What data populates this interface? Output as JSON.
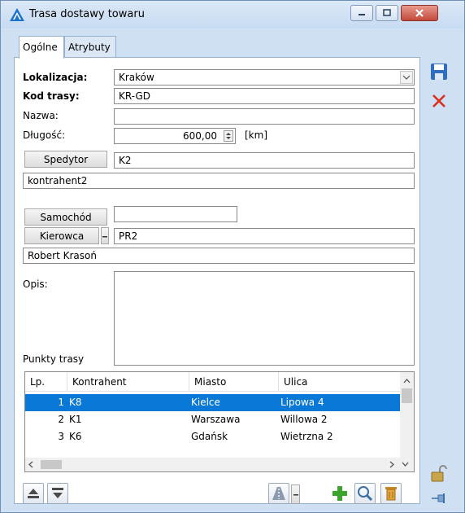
{
  "window": {
    "title": "Trasa dostawy towaru"
  },
  "tabs": [
    {
      "label": "Ogólne"
    },
    {
      "label": "Atrybuty"
    }
  ],
  "form": {
    "lokalizacja_label": "Lokalizacja:",
    "lokalizacja_value": "Kraków",
    "kod_label": "Kod trasy:",
    "kod_value": "KR-GD",
    "nazwa_label": "Nazwa:",
    "nazwa_value": "",
    "dlugosc_label": "Długość:",
    "dlugosc_value": "600,00",
    "dlugosc_unit": "[km]",
    "spedytor_button": "Spedytor",
    "spedytor_code": "K2",
    "spedytor_name": "kontrahent2",
    "samochod_button": "Samochód",
    "samochod_value": "",
    "kierowca_button": "Kierowca",
    "kierowca_code": "PR2",
    "kierowca_name": "Robert Krasoń",
    "opis_label": "Opis:",
    "opis_value": "",
    "punkty_label": "Punkty trasy"
  },
  "table": {
    "columns": [
      "Lp.",
      "Kontrahent",
      "Miasto",
      "Ulica"
    ],
    "rows": [
      {
        "lp": "1",
        "kontrahent": "K8",
        "miasto": "Kielce",
        "ulica": "Lipowa 4",
        "selected": true
      },
      {
        "lp": "2",
        "kontrahent": "K1",
        "miasto": "Warszawa",
        "ulica": "Willowa 2",
        "selected": false
      },
      {
        "lp": "3",
        "kontrahent": "K6",
        "miasto": "Gdańsk",
        "ulica": "Wietrzna 2",
        "selected": false
      }
    ]
  },
  "colors": {
    "selection": "#0a78d7",
    "window_bg": "#cfe0f3",
    "close_red": "#c34a3b",
    "green_plus": "#3aa52b"
  },
  "icons": [
    "app-icon",
    "minimize-icon",
    "maximize-icon",
    "close-icon",
    "save-icon",
    "cancel-icon",
    "spin-up-icon",
    "spin-down-icon",
    "dropdown-arrow-icon",
    "move-up-icon",
    "move-down-icon",
    "route-icon",
    "add-icon",
    "search-icon",
    "delete-icon",
    "lock-icon",
    "pin-icon"
  ]
}
